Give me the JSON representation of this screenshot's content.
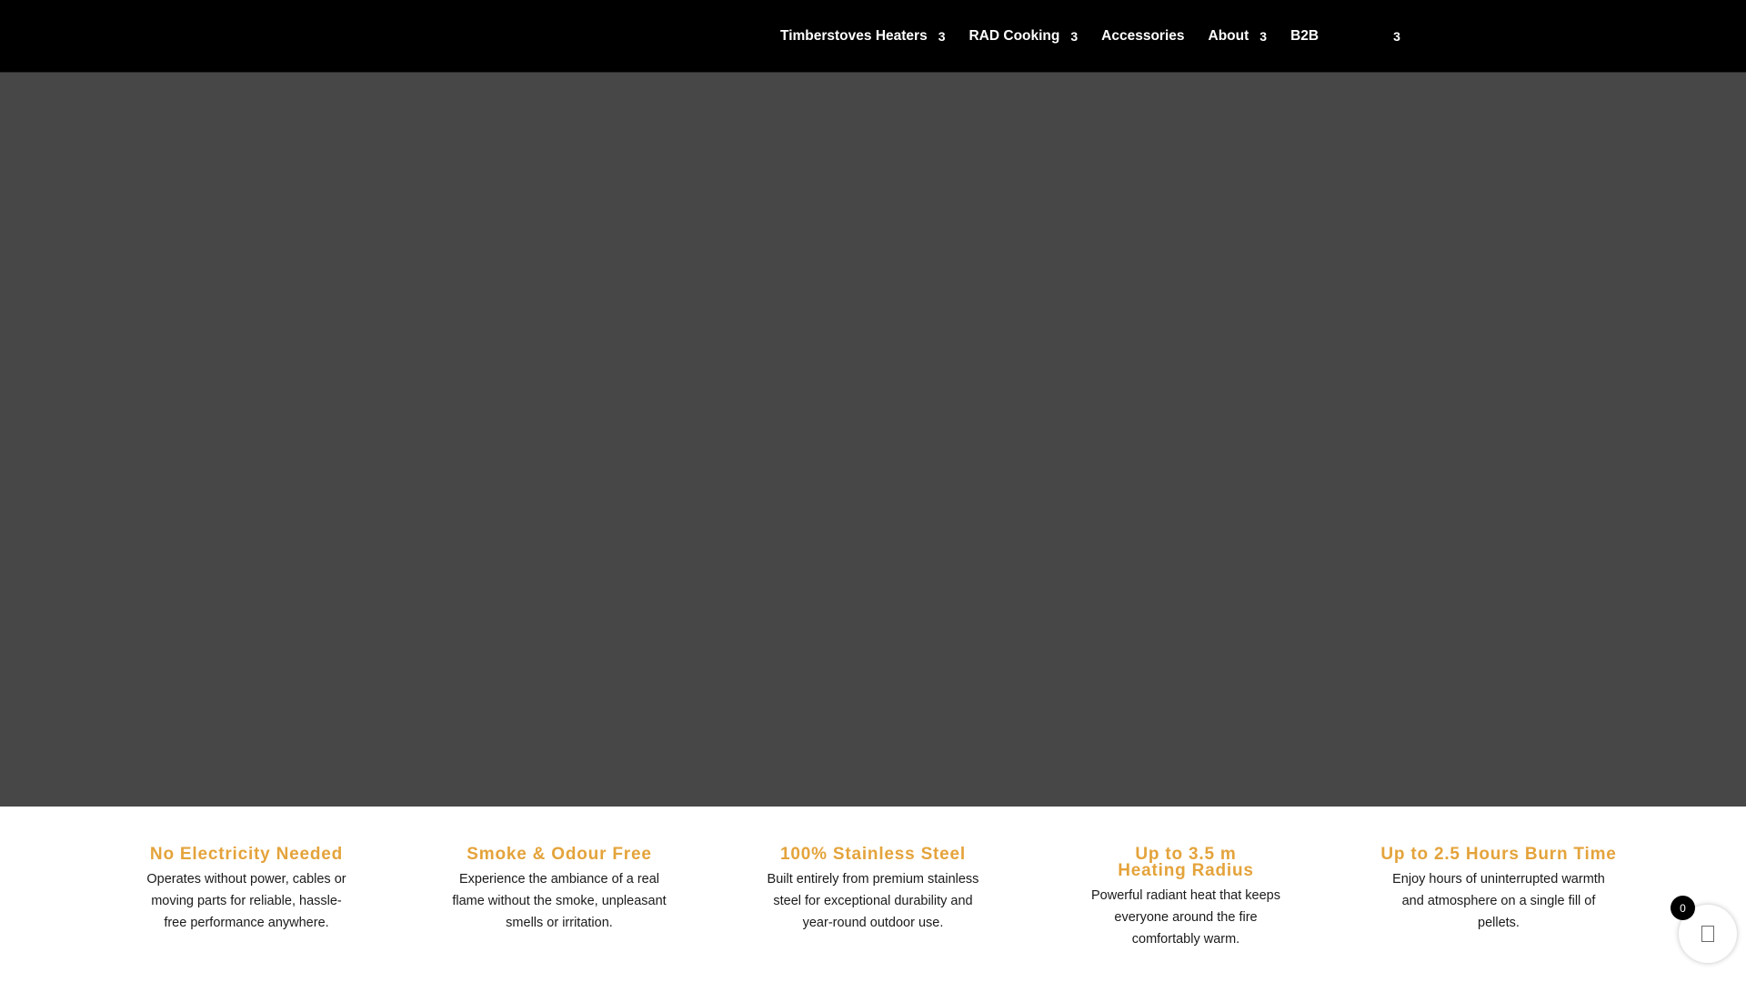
{
  "nav": {
    "items": [
      {
        "label": "Timberstoves Heaters",
        "has_dropdown": true,
        "chevron": "3"
      },
      {
        "label": "RAD Cooking",
        "has_dropdown": true,
        "chevron": "3"
      },
      {
        "label": "Accessories",
        "has_dropdown": false
      },
      {
        "label": "About",
        "has_dropdown": true,
        "chevron": "3"
      },
      {
        "label": "B2B",
        "has_dropdown": false
      }
    ],
    "language_chevron": "3"
  },
  "hero": {
    "background_color": "#474747"
  },
  "features": [
    {
      "title": "No Electricity Needed",
      "description": "Operates without power, cables or moving parts for reliable, hassle-free performance anywhere."
    },
    {
      "title": "Smoke & Odour Free",
      "description": "Experience the ambiance of a real flame without the smoke, unpleasant smells or irritation."
    },
    {
      "title": "100% Stainless Steel",
      "description": "Built entirely from premium stainless steel for exceptional durability and year-round outdoor use."
    },
    {
      "title": "Up to 3.5 m Heating Radius",
      "description": "Powerful radiant heat that keeps everyone around the fire comfortably warm."
    },
    {
      "title": "Up to 2.5 Hours Burn Time",
      "description": "Enjoy hours of uninterrupted warmth and atmosphere on a single fill of pellets."
    }
  ],
  "cart": {
    "count": "0",
    "icon": "shopping-bag-icon"
  },
  "colors": {
    "header_bg": "#000000",
    "accent": "#e4a33b",
    "body_text": "#1a1a1a"
  }
}
